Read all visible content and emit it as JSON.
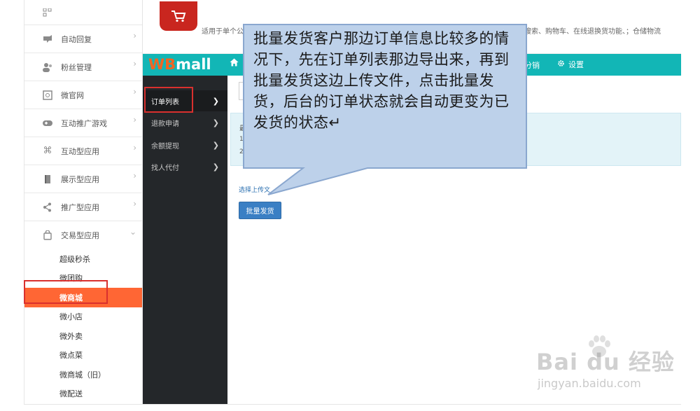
{
  "left_menu": {
    "items": [
      {
        "label": "",
        "icon": "grid-icon"
      },
      {
        "label": "自动回复",
        "icon": "reply-icon"
      },
      {
        "label": "粉丝管理",
        "icon": "users-icon"
      },
      {
        "label": "微官网",
        "icon": "website-icon"
      },
      {
        "label": "互动推广游戏",
        "icon": "gamepad-icon"
      },
      {
        "label": "互动型应用",
        "icon": "command-icon"
      },
      {
        "label": "展示型应用",
        "icon": "book-icon"
      },
      {
        "label": "推广型应用",
        "icon": "share-icon"
      },
      {
        "label": "交易型应用",
        "icon": "bag-icon"
      }
    ],
    "sub_items": [
      {
        "label": "超级秒杀"
      },
      {
        "label": "微团购"
      },
      {
        "label": "微商城"
      },
      {
        "label": "微小店"
      },
      {
        "label": "微外卖"
      },
      {
        "label": "微点菜"
      },
      {
        "label": "微商城（旧）"
      },
      {
        "label": "微配送"
      }
    ],
    "active_sub": "微商城"
  },
  "top": {
    "desc_left": "适用于单个公",
    "desc_right": "搜索、购物车、在线退换货功能、；仓储物流"
  },
  "navbar": {
    "logo_wb": "WB",
    "logo_mall": "mall",
    "promo": "分销",
    "settings": "设置",
    "accent": "#12b6b6"
  },
  "dark_sidebar": {
    "items": [
      {
        "label": "订单列表"
      },
      {
        "label": "退款申请"
      },
      {
        "label": "余额提现"
      },
      {
        "label": "找人代付"
      }
    ]
  },
  "content": {
    "notice_lines": [
      "最",
      "1",
      "2"
    ],
    "upload_link": "选择上传文",
    "batch_button": "批量发货"
  },
  "callout": {
    "text": "批量发货客户那边订单信息比较多的情况下，先在订单列表那边导出来，再到批量发货这边上传文件，点击批量发货，后台的订单状态就会自动更变为已发货的状态↵"
  },
  "watermark": {
    "main": "Bai du 经验",
    "sub": "jingyan.baidu.com"
  }
}
